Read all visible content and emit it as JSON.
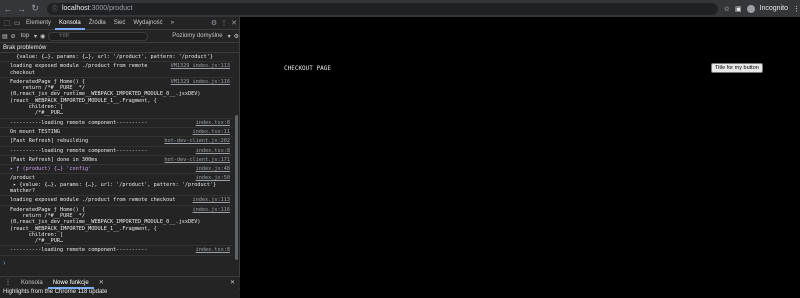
{
  "browser": {
    "url_host": "localhost",
    "url_path": ":3000/product",
    "profile_label": "Incognito"
  },
  "devtools": {
    "tabs": [
      "Elementy",
      "Konsola",
      "Źródła",
      "Sieć",
      "Wydajność"
    ],
    "active_tab": "Konsola",
    "more_tabs": "»",
    "context": "top",
    "filter_placeholder": "Filtr",
    "levels": "Poziomy domyślne",
    "issues": "Brak problemów",
    "console_lines": [
      {
        "text": "  {value: {…}, params: {…}, url: '/product', pattern: '/product'}",
        "src": ""
      },
      {
        "text": "loading exposed module ./product from remote\ncheckout",
        "src": "VM1329 index.js:113"
      },
      {
        "text": "FederatedPage ƒ Home() {\n    return /*#__PURE__*/\n(0,react_jsx_dev_runtime__WEBPACK_IMPORTED_MODULE_0__.jsxDEV)\n(react__WEBPACK_IMPORTED_MODULE_1__.Fragment, {\n      children: [\n        /*#__PUR…",
        "src": "VM1329 index.js:116"
      },
      {
        "text": "----------loading remote component----------",
        "src": "index.tsx:8"
      },
      {
        "text": "On mount TESTING",
        "src": "index.tsx:11"
      },
      {
        "text": "[Fast Refresh] rebuilding",
        "src": "hot-dev-client.js:202"
      },
      {
        "text": "----------loading remote component----------",
        "src": "index.tsx:8"
      },
      {
        "text": "[Fast Refresh] done in 300ms",
        "src": "hot-dev-client.js:171"
      },
      {
        "text": "▸ ƒ (product) {…} 'config'",
        "src": "index.js:48"
      },
      {
        "text": "/product\n ▸ {value: {…}, params: {…}, url: '/product', pattern: '/product'}\nmatcher?",
        "src": "index.js:50"
      },
      {
        "text": "loading exposed module ./product from remote checkout",
        "src": "index.js:113"
      },
      {
        "text": "FederatedPage ƒ Home() {\n    return /*#__PURE__*/\n(0,react_jsx_dev_runtime__WEBPACK_IMPORTED_MODULE_0__.jsxDEV)\n(react__WEBPACK_IMPORTED_MODULE_1__.Fragment, {\n      children: [\n        /*#__PUR…",
        "src": "index.js:116"
      },
      {
        "text": "----------loading remote component----------",
        "src": "index.tsx:8"
      }
    ],
    "prompt": "›",
    "drawer_tabs": [
      "Konsola",
      "Nowe funkcje"
    ],
    "drawer_active": "Nowe funkcje",
    "highlights": "Highlights from the Chrome 118 update"
  },
  "page": {
    "heading": "CHECKOUT PAGE",
    "button_label": "Title for my button"
  }
}
